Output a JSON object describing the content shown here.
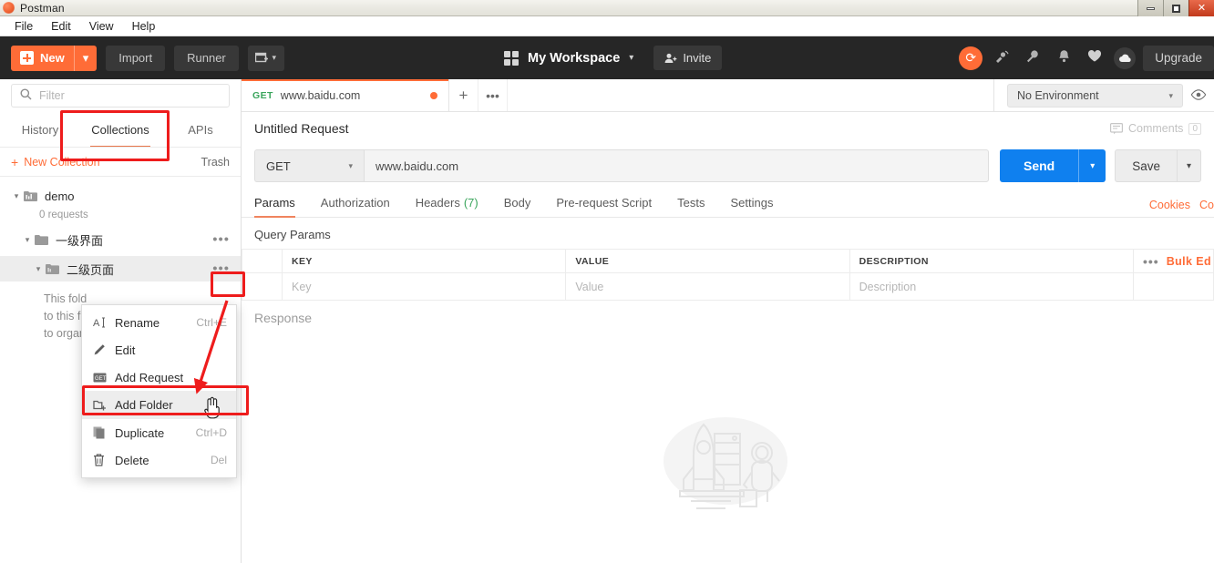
{
  "window": {
    "app_title": "Postman",
    "app_icon": "postman-logo-icon",
    "minimize": "–",
    "maximize": "□",
    "close": "✕"
  },
  "menubar": {
    "items": [
      "File",
      "Edit",
      "View",
      "Help"
    ]
  },
  "header": {
    "new_button": "New",
    "new_caret": "▾",
    "import_button": "Import",
    "runner_button": "Runner",
    "new_window_caret": "▾",
    "workspace_name": "My Workspace",
    "workspace_caret": "▾",
    "invite_button": "Invite",
    "sync_icon": "sync-icon",
    "icons": [
      "satellite-icon",
      "wrench-icon",
      "bell-icon",
      "heart-icon"
    ],
    "cloud_icon": "cloud-icon",
    "upgrade_button": "Upgrade",
    "accent_color": "#ff6c37",
    "bg_color": "#262626"
  },
  "sidebar": {
    "filter_placeholder": "Filter",
    "tabs": [
      {
        "label": "History",
        "active": false
      },
      {
        "label": "Collections",
        "active": true
      },
      {
        "label": "APIs",
        "active": false
      }
    ],
    "new_collection": "New Collection",
    "trash": "Trash",
    "tree": [
      {
        "label": "demo",
        "sub": "0 requests",
        "twisty": "▾",
        "icon": "collection-icon",
        "depth": 0
      },
      {
        "label": "一级界面",
        "twisty": "▾",
        "icon": "folder-icon",
        "depth": 1
      },
      {
        "label": "二级页面",
        "twisty": "▾",
        "icon": "folder-icon",
        "depth": 2,
        "selected": true
      }
    ],
    "folder_description": [
      "This fold",
      "to this f",
      "to organ"
    ]
  },
  "context_menu": {
    "items": [
      {
        "label": "Rename",
        "shortcut": "Ctrl+E",
        "icon": "text-cursor-icon"
      },
      {
        "label": "Edit",
        "shortcut": "",
        "icon": "pencil-icon"
      },
      {
        "label": "Add Request",
        "shortcut": "",
        "icon": "request-icon"
      },
      {
        "label": "Add Folder",
        "shortcut": "",
        "icon": "add-folder-icon",
        "highlighted": true
      },
      {
        "label": "Duplicate",
        "shortcut": "Ctrl+D",
        "icon": "duplicate-icon"
      },
      {
        "label": "Delete",
        "shortcut": "Del",
        "icon": "trash-icon"
      }
    ]
  },
  "main": {
    "request_tab": {
      "method": "GET",
      "url": "www.baidu.com",
      "unsaved_dot": true
    },
    "new_tab_icon": "plus-icon",
    "tab_options_icon": "ellipsis-icon",
    "environment": {
      "selected": "No Environment",
      "caret": "▾",
      "eye_icon": "eye-icon"
    },
    "request_title": "Untitled Request",
    "comments_label": "Comments",
    "comments_count": "0",
    "method_selected": "GET",
    "method_caret": "▾",
    "url_value": "www.baidu.com",
    "send_label": "Send",
    "send_caret": "▾",
    "save_label": "Save",
    "save_caret": "▾",
    "send_color": "#0f80ef",
    "tabs": [
      {
        "label": "Params",
        "active": true
      },
      {
        "label": "Authorization",
        "active": false
      },
      {
        "label": "Headers",
        "count": "(7)",
        "active": false
      },
      {
        "label": "Body",
        "active": false
      },
      {
        "label": "Pre-request Script",
        "active": false
      },
      {
        "label": "Tests",
        "active": false
      },
      {
        "label": "Settings",
        "active": false
      }
    ],
    "cookies_link": "Cookies",
    "code_link": "Co",
    "query_params_title": "Query Params",
    "params_table": {
      "headers": [
        "KEY",
        "VALUE",
        "DESCRIPTION"
      ],
      "rows": [
        [
          "Key",
          "Value",
          "Description"
        ]
      ],
      "row_options_icon": "ellipsis-icon",
      "bulk_edit": "Bulk Ed"
    },
    "response_label": "Response",
    "empty_illustration": "rocket-astronaut-icon"
  },
  "annotations": {
    "highlight_color": "#ee1c1c",
    "boxes": [
      "collections-tab-highlight",
      "folder-options-highlight",
      "add-folder-highlight"
    ],
    "arrow": "pointer-arrow"
  }
}
